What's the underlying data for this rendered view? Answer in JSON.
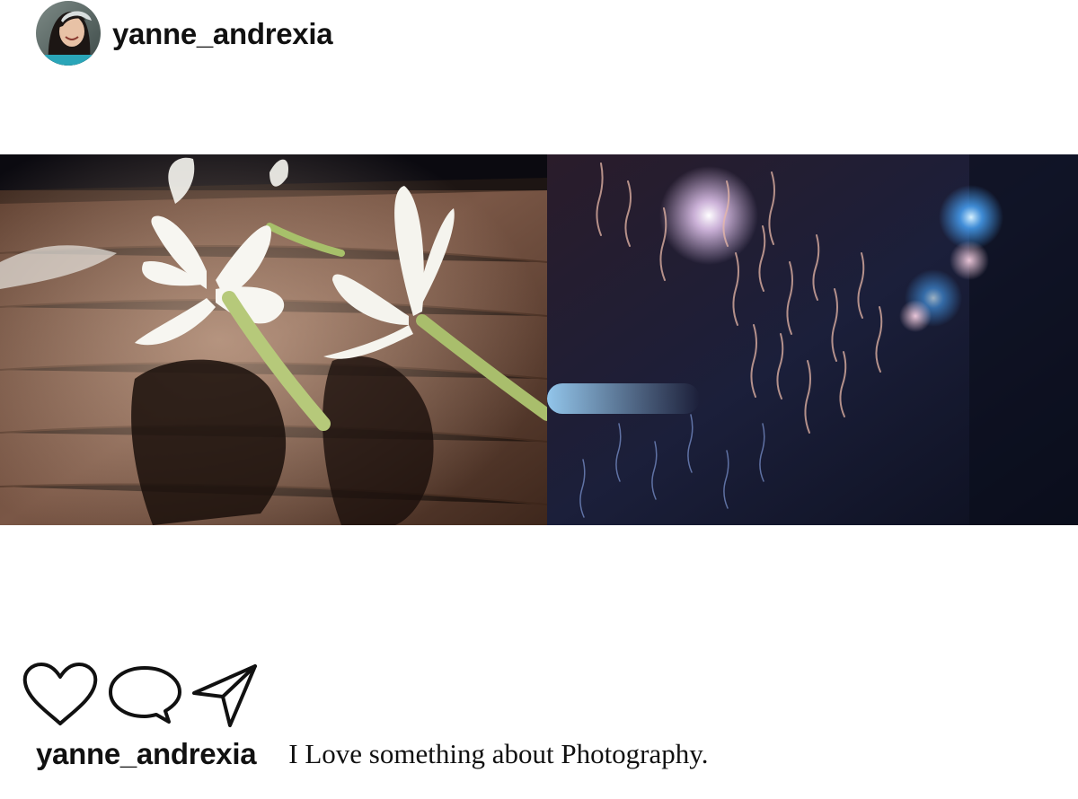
{
  "post": {
    "username": "yanne_andrexia",
    "avatar_icon": "profile-photo",
    "caption_username": "yanne_andrexia",
    "caption_text": "I Love something about Photography.",
    "photos": [
      {
        "icon": "white-flowers-on-wooden-table-photo"
      },
      {
        "icon": "rainy-window-night-lights-photo"
      }
    ]
  },
  "actions": [
    {
      "icon": "heart-icon"
    },
    {
      "icon": "comment-icon"
    },
    {
      "icon": "share-paper-plane-icon"
    }
  ]
}
